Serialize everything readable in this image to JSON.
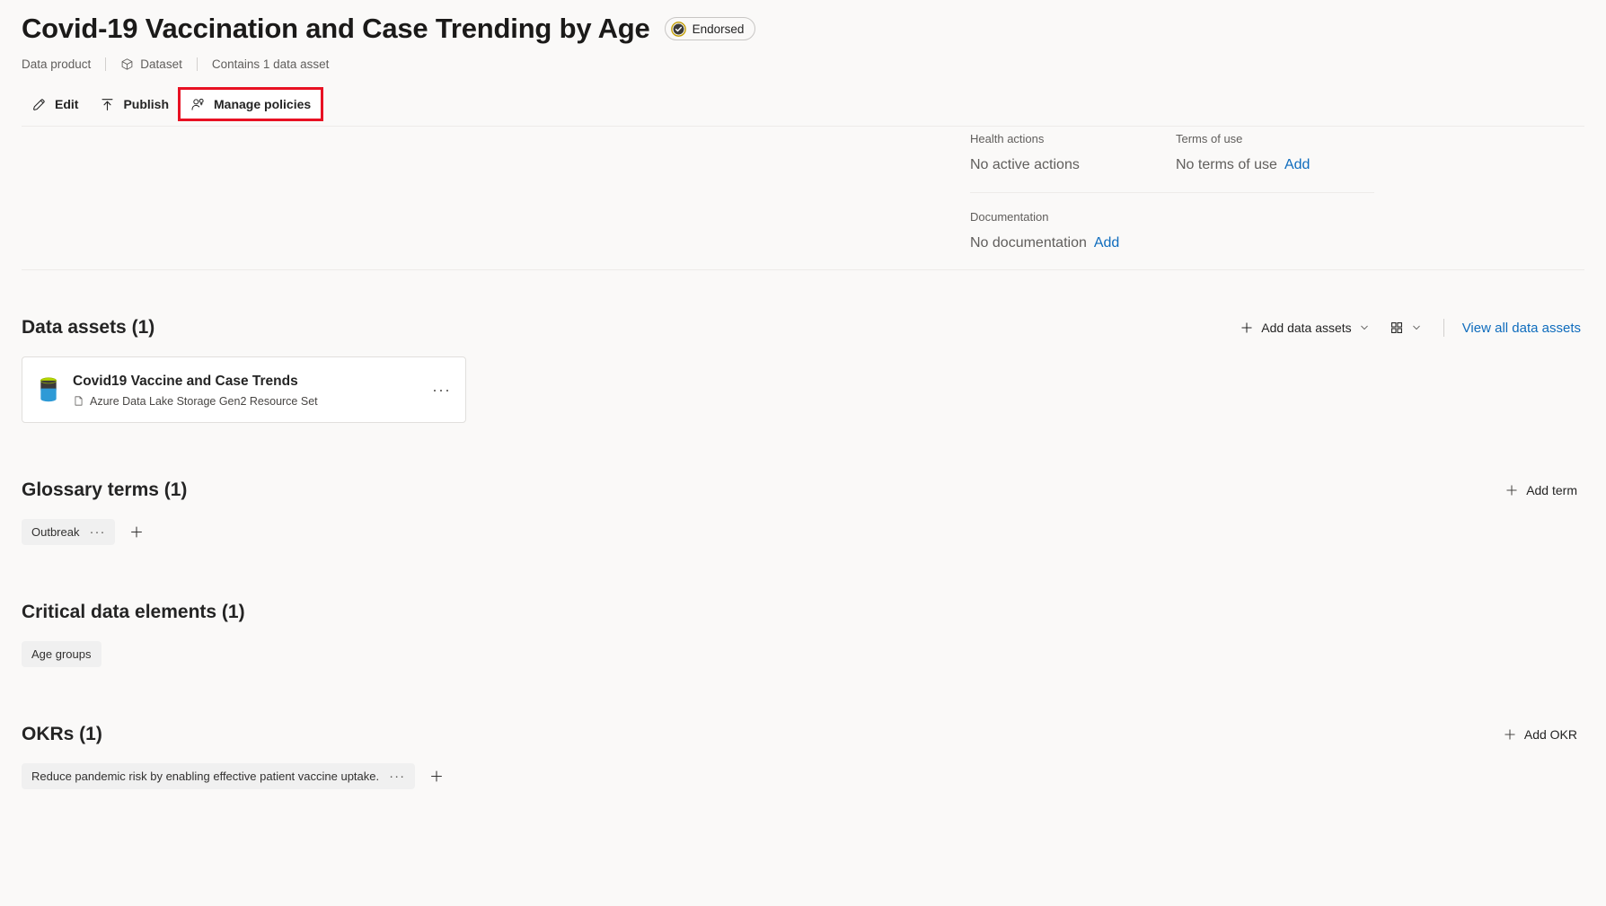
{
  "header": {
    "title": "Covid-19 Vaccination and Case Trending by Age",
    "endorsed_label": "Endorsed",
    "meta": {
      "kind": "Data product",
      "type": "Dataset",
      "contains": "Contains 1 data asset"
    }
  },
  "commandbar": {
    "edit": "Edit",
    "publish": "Publish",
    "manage_policies": "Manage policies",
    "highlight_color": "#e81123"
  },
  "info": {
    "health_actions_label": "Health actions",
    "health_actions_value": "No active actions",
    "terms_label": "Terms of use",
    "terms_value": "No terms of use",
    "terms_add": "Add",
    "documentation_label": "Documentation",
    "documentation_value": "No documentation",
    "documentation_add": "Add"
  },
  "data_assets": {
    "title": "Data assets (1)",
    "add_label": "Add data assets",
    "view_all_label": "View all data assets",
    "items": [
      {
        "name": "Covid19 Vaccine and Case Trends",
        "type": "Azure Data Lake Storage Gen2 Resource Set",
        "more": "···"
      }
    ]
  },
  "glossary": {
    "title": "Glossary terms (1)",
    "add_label": "Add term",
    "items": [
      {
        "label": "Outbreak",
        "more": "···"
      }
    ]
  },
  "critical_data_elements": {
    "title": "Critical data elements (1)",
    "items": [
      {
        "label": "Age groups"
      }
    ]
  },
  "okrs": {
    "title": "OKRs (1)",
    "add_label": "Add OKR",
    "items": [
      {
        "label": "Reduce pandemic risk by enabling effective patient vaccine uptake.",
        "more": "···"
      }
    ]
  },
  "colors": {
    "link": "#0f6cbd",
    "page_bg": "#faf9f8",
    "endorsed_ring": "#c19c00"
  }
}
